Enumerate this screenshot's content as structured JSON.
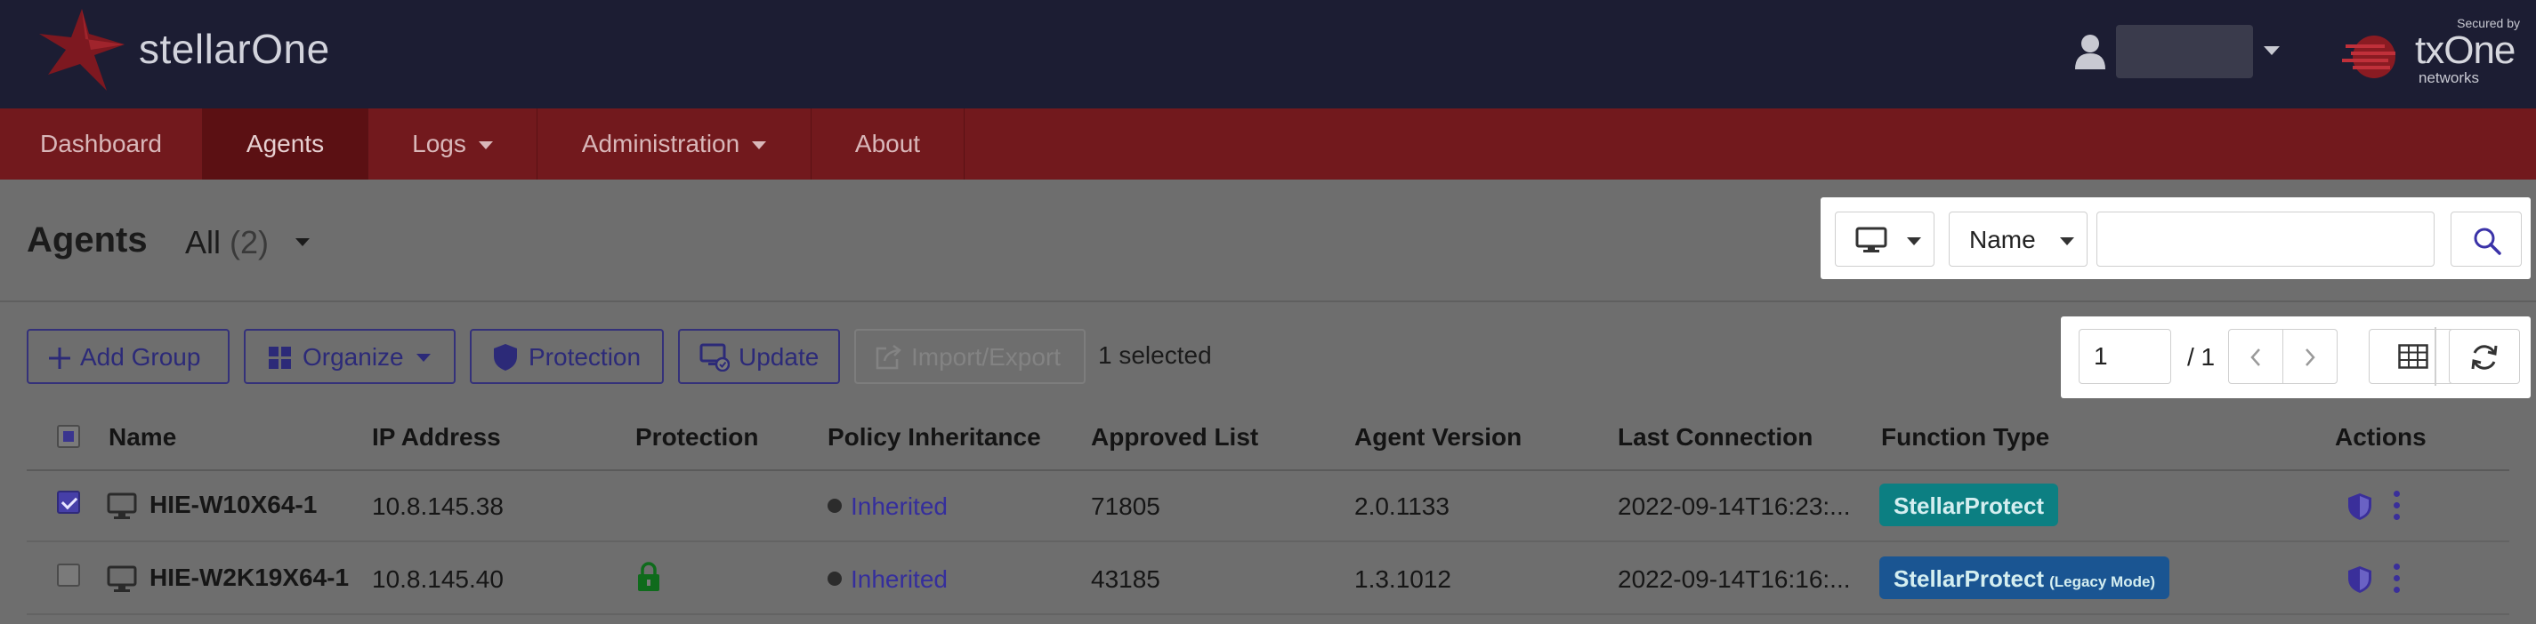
{
  "brand": {
    "name": "stellarOne",
    "partner_name": "txOne",
    "partner_sub": "networks",
    "partner_tag": "Secured by"
  },
  "nav": {
    "items": [
      {
        "label": "Dashboard"
      },
      {
        "label": "Agents"
      },
      {
        "label": "Logs"
      },
      {
        "label": "Administration"
      },
      {
        "label": "About"
      }
    ]
  },
  "header": {
    "title": "Agents",
    "filter_label": "All",
    "filter_count": "(2)"
  },
  "search": {
    "field_label": "Name",
    "query": ""
  },
  "toolbar": {
    "add_group": "Add Group",
    "organize": "Organize",
    "protection": "Protection",
    "update": "Update",
    "import_export": "Import/Export",
    "selected": "1 selected"
  },
  "pager": {
    "current": "1",
    "total": "/ 1"
  },
  "table": {
    "columns": [
      "Name",
      "IP Address",
      "Protection",
      "Policy Inheritance",
      "Approved List",
      "Agent Version",
      "Last Connection",
      "Function Type",
      "Actions"
    ],
    "rows": [
      {
        "name": "HIE-W10X64-1",
        "ip": "10.8.145.38",
        "policy": "Inherited",
        "approved": "71805",
        "version": "2.0.1133",
        "last_connection": "2022-09-14T16:23:...",
        "function": "StellarProtect",
        "function_suffix": ""
      },
      {
        "name": "HIE-W2K19X64-1",
        "ip": "10.8.145.40",
        "policy": "Inherited",
        "approved": "43185",
        "version": "1.3.1012",
        "last_connection": "2022-09-14T16:16:...",
        "function": "StellarProtect",
        "function_suffix": "(Legacy Mode)"
      }
    ]
  },
  "colors": {
    "topbar": "#1c1d33",
    "nav": "#72191d",
    "accent": "#352e9c",
    "badge_teal": "#0c7f82",
    "badge_blue": "#1a5592",
    "lock_green": "#0f6b1c"
  }
}
